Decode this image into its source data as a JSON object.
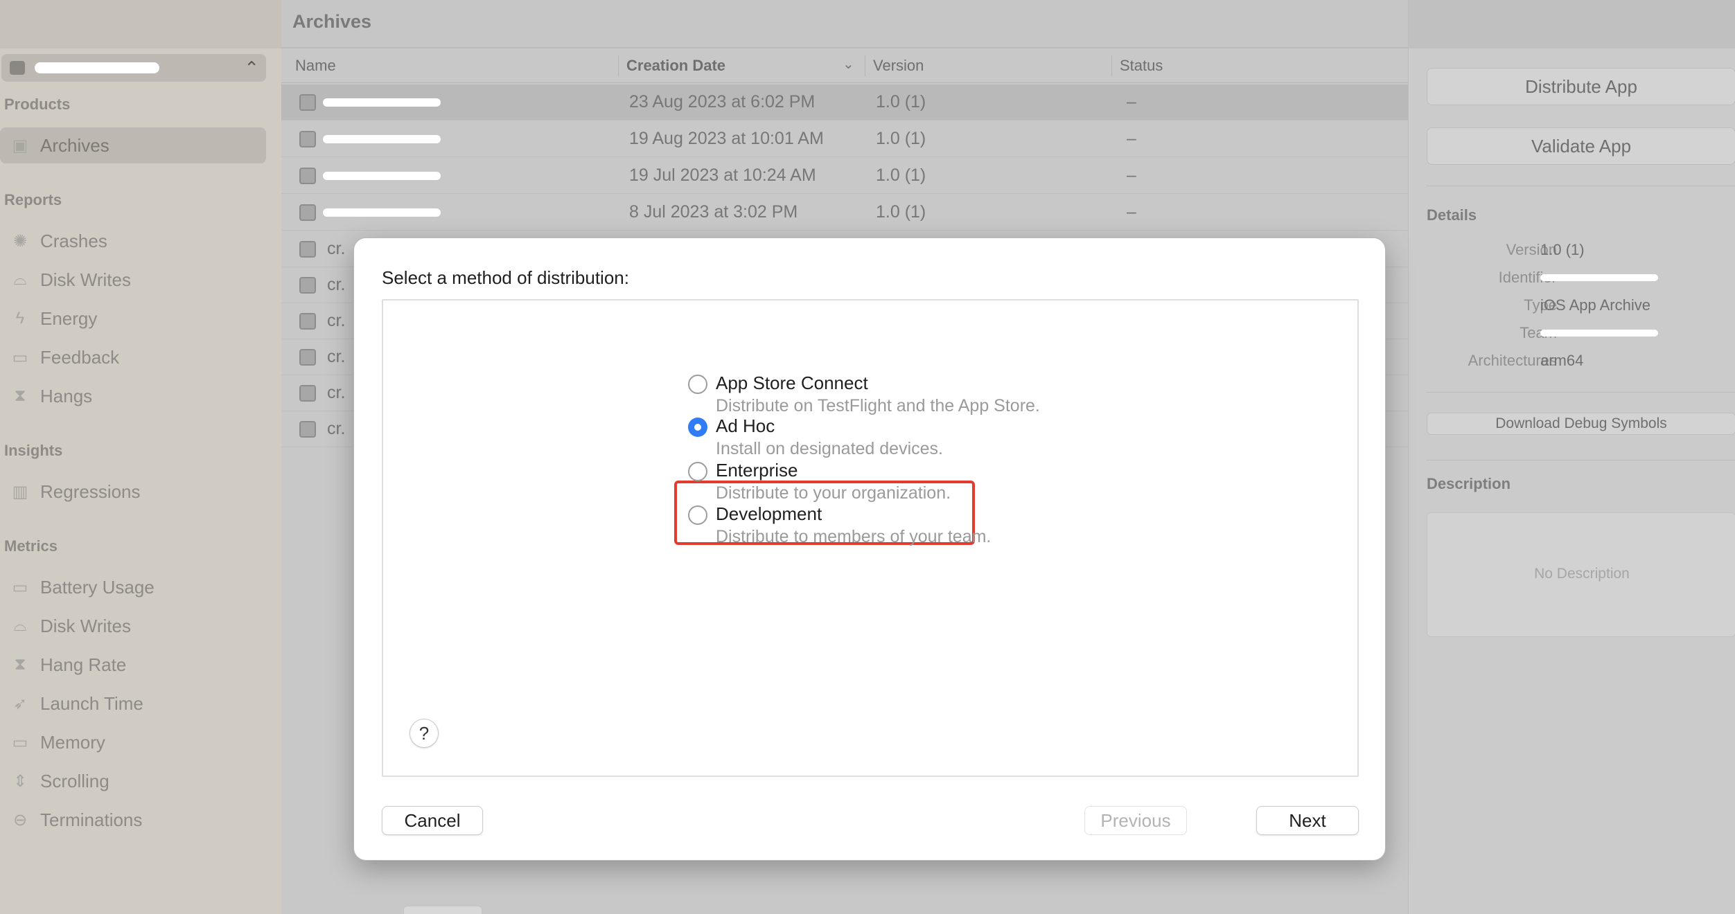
{
  "sidebar": {
    "scheme_selector": {
      "icon": "app-store-icon",
      "value": ""
    },
    "sections": [
      {
        "label": "Products"
      },
      {
        "label": "Reports"
      },
      {
        "label": "Insights"
      },
      {
        "label": "Metrics"
      }
    ],
    "items": [
      {
        "label": "Archives",
        "icon": "archive-icon",
        "selected": true
      },
      {
        "label": "Crashes",
        "icon": "crash-icon"
      },
      {
        "label": "Disk Writes",
        "icon": "drive-icon"
      },
      {
        "label": "Energy",
        "icon": "bolt-icon"
      },
      {
        "label": "Feedback",
        "icon": "speech-bubble-icon"
      },
      {
        "label": "Hangs",
        "icon": "hourglass-icon"
      },
      {
        "label": "Regressions",
        "icon": "bar-chart-icon"
      },
      {
        "label": "Battery Usage",
        "icon": "battery-icon"
      },
      {
        "label": "Disk Writes",
        "icon": "drive-icon"
      },
      {
        "label": "Hang Rate",
        "icon": "hourglass-icon"
      },
      {
        "label": "Launch Time",
        "icon": "rocket-icon"
      },
      {
        "label": "Memory",
        "icon": "memory-chip-icon"
      },
      {
        "label": "Scrolling",
        "icon": "scroll-icon"
      },
      {
        "label": "Terminations",
        "icon": "stop-circle-icon"
      }
    ]
  },
  "main": {
    "title": "Archives",
    "columns": {
      "name": "Name",
      "creation_date": "Creation Date",
      "version": "Version",
      "status": "Status"
    },
    "rows": [
      {
        "name": "",
        "date": "23 Aug 2023 at 6:02 PM",
        "version": "1.0 (1)",
        "status": "–"
      },
      {
        "name": "",
        "date": "19 Aug 2023 at 10:01 AM",
        "version": "1.0 (1)",
        "status": "–"
      },
      {
        "name": "",
        "date": "19 Jul 2023 at 10:24 AM",
        "version": "1.0 (1)",
        "status": "–"
      },
      {
        "name": "",
        "date": "8 Jul 2023 at 3:02 PM",
        "version": "1.0 (1)",
        "status": "–"
      },
      {
        "name": "cr."
      },
      {
        "name": "cr."
      },
      {
        "name": "cr."
      },
      {
        "name": "cr."
      },
      {
        "name": "cr."
      },
      {
        "name": "cr."
      }
    ]
  },
  "inspector": {
    "distribute_label": "Distribute App",
    "validate_label": "Validate App",
    "details_heading": "Details",
    "details": [
      {
        "label": "Version",
        "value": "1.0 (1)"
      },
      {
        "label": "Identifier",
        "value": ""
      },
      {
        "label": "Type",
        "value": "iOS App Archive"
      },
      {
        "label": "Team",
        "value": ""
      },
      {
        "label": "Architectures",
        "value": "arm64"
      }
    ],
    "download_symbols_label": "Download Debug Symbols",
    "description_heading": "Description",
    "description_placeholder": "No Description"
  },
  "dialog": {
    "prompt": "Select a method of distribution:",
    "options": [
      {
        "title": "App Store Connect",
        "description": "Distribute on TestFlight and the App Store.",
        "selected": false
      },
      {
        "title": "Ad Hoc",
        "description": "Install on designated devices.",
        "selected": true
      },
      {
        "title": "Enterprise",
        "description": "Distribute to your organization.",
        "selected": false
      },
      {
        "title": "Development",
        "description": "Distribute to members of your team.",
        "selected": false
      }
    ],
    "help_label": "?",
    "cancel_label": "Cancel",
    "previous_label": "Previous",
    "next_label": "Next"
  },
  "colors": {
    "accent": "#2f7cf6",
    "highlight_box": "#e33b2e"
  }
}
